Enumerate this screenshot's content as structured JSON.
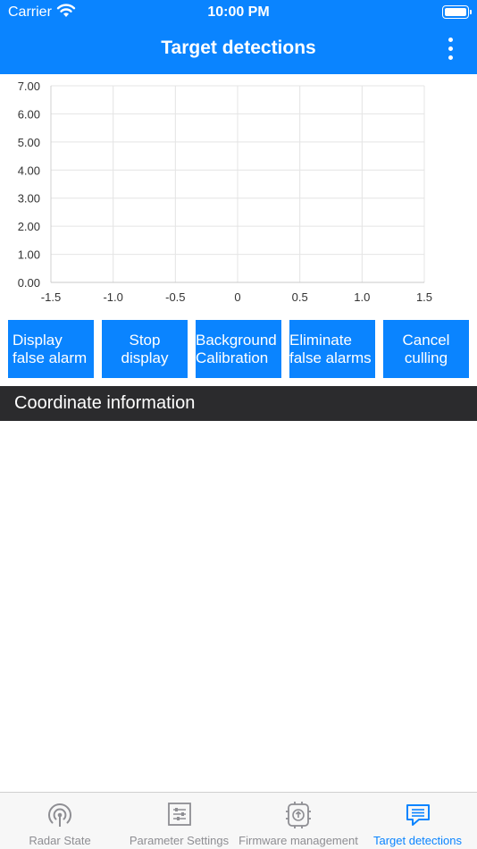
{
  "status_bar": {
    "carrier": "Carrier",
    "time": "10:00 PM"
  },
  "nav": {
    "title": "Target detections",
    "more_icon": "more-vertical-icon"
  },
  "chart_data": {
    "type": "scatter",
    "title": "",
    "xlabel": "",
    "ylabel": "",
    "xlim": [
      -1.5,
      1.5
    ],
    "ylim": [
      0,
      7
    ],
    "x_ticks": [
      "-1.5",
      "-1.0",
      "-0.5",
      "0",
      "0.5",
      "1.0",
      "1.5"
    ],
    "y_ticks": [
      "0.00",
      "1.00",
      "2.00",
      "3.00",
      "4.00",
      "5.00",
      "6.00",
      "7.00"
    ],
    "series": [],
    "grid": true
  },
  "buttons": [
    {
      "line1": "Display",
      "line2": "false alarm",
      "align": "left"
    },
    {
      "line1": "Stop",
      "line2": "display",
      "align": "center"
    },
    {
      "line1": "Background",
      "line2": "Calibration",
      "align": "left"
    },
    {
      "line1": "Eliminate",
      "line2": "false alarms",
      "align": "left"
    },
    {
      "line1": "Cancel",
      "line2": "culling",
      "align": "center"
    }
  ],
  "section": {
    "title": "Coordinate information"
  },
  "tabs": [
    {
      "label": "Radar State",
      "icon": "radar-icon",
      "active": false
    },
    {
      "label": "Parameter Settings",
      "icon": "sliders-icon",
      "active": false
    },
    {
      "label": "Firmware management",
      "icon": "chip-upload-icon",
      "active": false
    },
    {
      "label": "Target detections",
      "icon": "message-icon",
      "active": true
    }
  ],
  "colors": {
    "accent": "#0a84ff",
    "section_bg": "#2b2b2d",
    "inactive": "#8e8e93"
  }
}
